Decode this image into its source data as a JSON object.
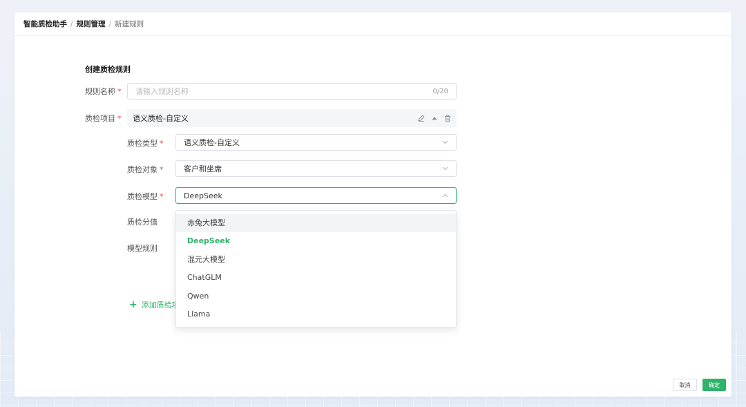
{
  "breadcrumb": {
    "root": "智能质检助手",
    "parent": "规则管理",
    "current": "新建规则",
    "separator": "/"
  },
  "form": {
    "title": "创建质检规则",
    "rule_name": {
      "label": "规则名称",
      "placeholder": "请输入规则名称",
      "count": "0/20"
    },
    "qc_item_label": "质检项目",
    "item": {
      "title": "语义质检-自定义",
      "icons": [
        "edit-icon",
        "caret-up-icon",
        "trash-icon"
      ],
      "fields": {
        "type": {
          "label": "质检类型",
          "value": "语义质检-自定义"
        },
        "target": {
          "label": "质检对象",
          "value": "客户和坐席"
        },
        "model": {
          "label": "质检模型",
          "value": "DeepSeek"
        },
        "score": {
          "label": "质检分值"
        },
        "rule": {
          "label": "模型规则"
        }
      }
    },
    "add_item": "添加质检项"
  },
  "dropdown": {
    "options": [
      "赤兔大模型",
      "DeepSeek",
      "混元大模型",
      "ChatGLM",
      "Qwen",
      "Llama"
    ],
    "hovered": "赤兔大模型",
    "selected": "DeepSeek"
  },
  "actions": {
    "cancel": "取消",
    "confirm": "确定"
  },
  "colors": {
    "accent": "#2fb36a",
    "required": "#e5484d"
  }
}
